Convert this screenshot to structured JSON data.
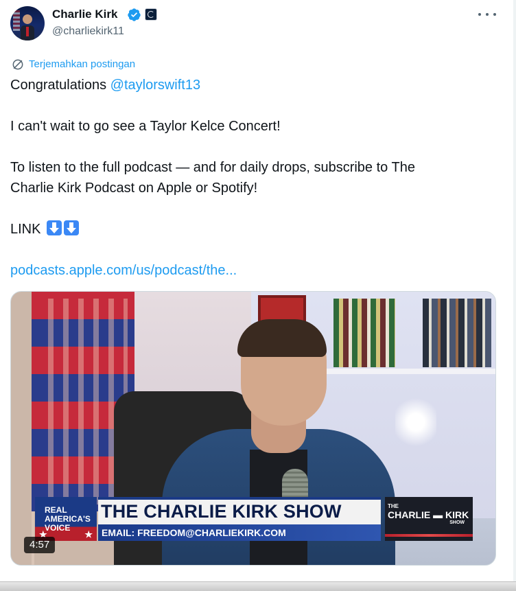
{
  "author": {
    "name": "Charlie Kirk",
    "handle": "@charliekirk11",
    "verified": true,
    "avatar_icon": "avatar-icon",
    "org_badge_icon": "affiliate-badge-icon"
  },
  "menu": {
    "more_icon": "more-horizontal-icon"
  },
  "translate": {
    "label": "Terjemahkan postingan",
    "icon": "translate-icon"
  },
  "post": {
    "line1_prefix": "Congratulations ",
    "line1_mention": "@taylorswift13",
    "line2": "I can't wait to go see a Taylor Kelce Concert!",
    "line3a": "To listen to the full podcast  — and for daily drops, subscribe to The",
    "line3b": "Charlie Kirk Podcast on Apple or Spotify!",
    "line4": "LINK",
    "link": "podcasts.apple.com/us/podcast/the..."
  },
  "video": {
    "duration": "4:57",
    "lower_third": {
      "network_line1": "REAL",
      "network_line2": "AMERICA'S",
      "network_line3": "VOICE",
      "title": "THE CHARLIE KIRK SHOW",
      "email": "EMAIL: FREEDOM@CHARLIEKIRK.COM",
      "logo_the": "THE",
      "logo_name": "CHARLIE ▬ KIRK",
      "logo_show": "SHOW"
    }
  },
  "colors": {
    "accent": "#1d9bf0",
    "text": "#0f1419",
    "muted": "#536471"
  }
}
